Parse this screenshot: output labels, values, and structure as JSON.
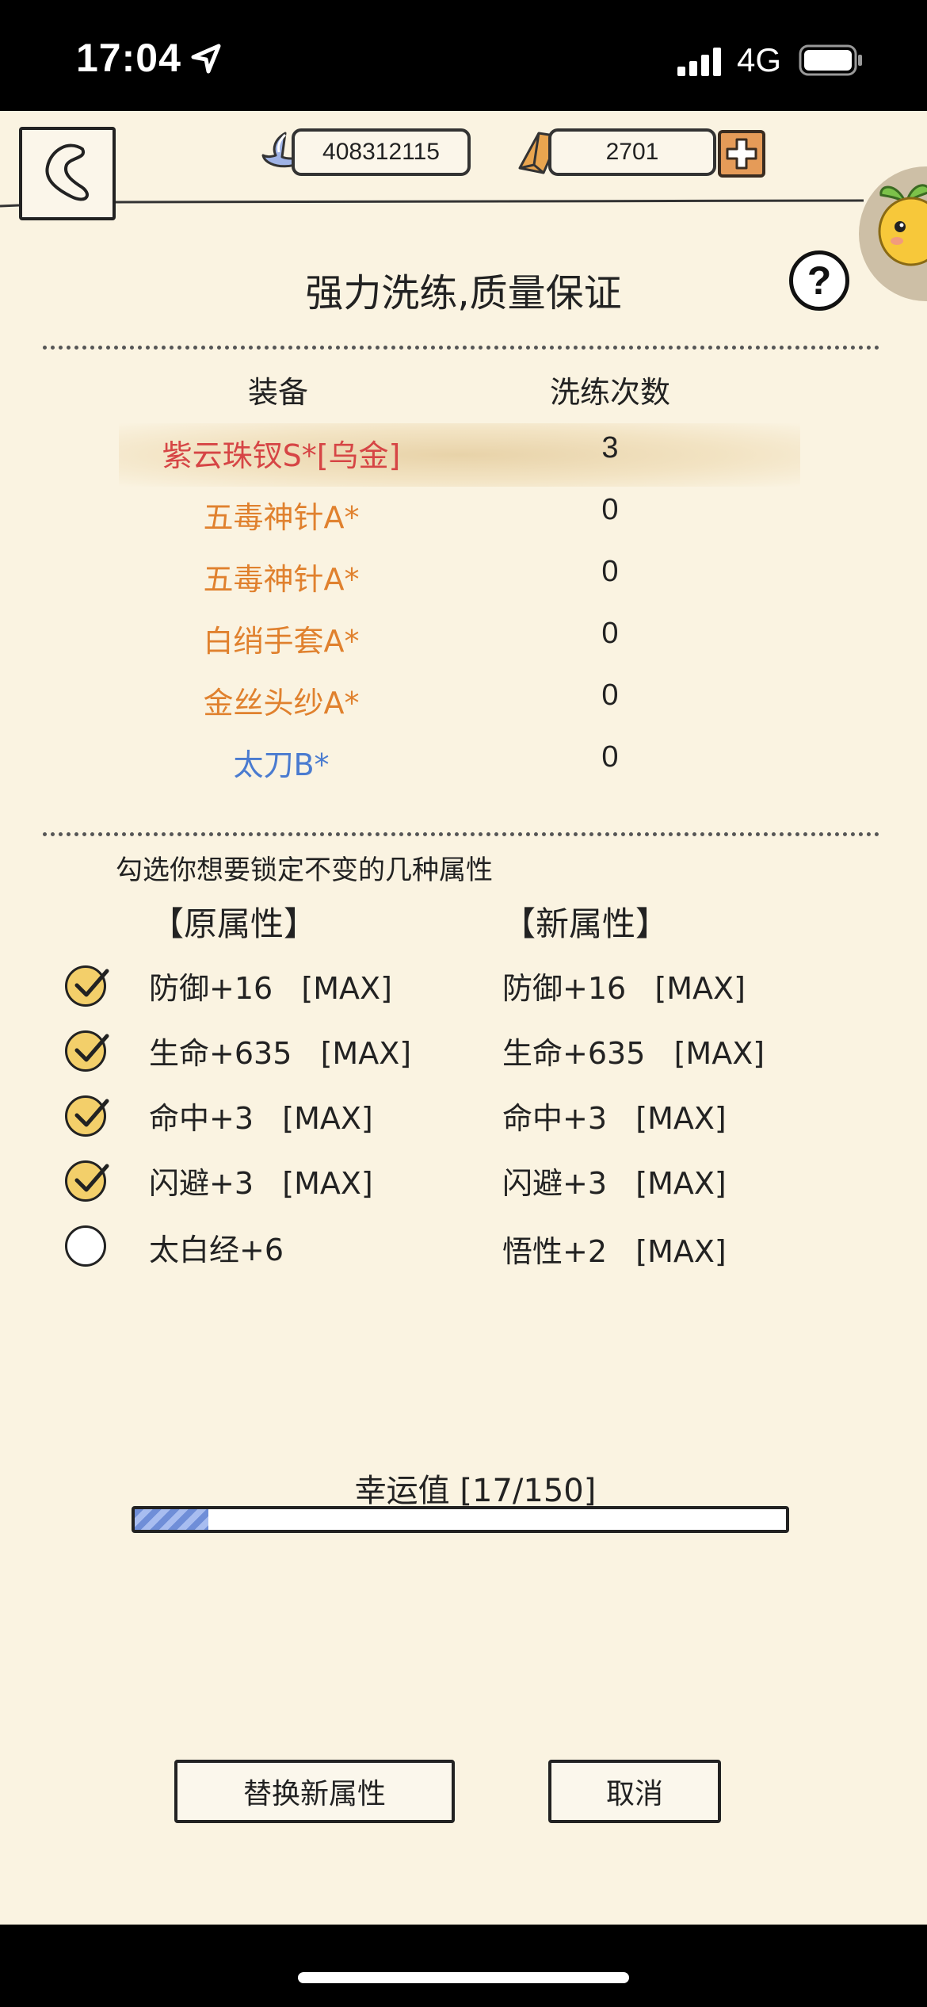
{
  "status_bar": {
    "time": "17:04",
    "network": "4G",
    "icons": [
      "location-arrow-icon",
      "signal-bars-icon",
      "battery-icon"
    ]
  },
  "header": {
    "back_icon": "back-arrow-icon",
    "silver": "408312115",
    "gold": "2701",
    "add_icon": "plus-icon"
  },
  "title": "强力洗练,质量保证",
  "help_label": "?",
  "equipment": {
    "header_name": "装备",
    "header_count": "洗练次数",
    "items": [
      {
        "name": "紫云珠钗S*[乌金]",
        "count": "3",
        "color": "#d64545"
      },
      {
        "name": "五毒神针A*",
        "count": "0",
        "color": "#e0812e"
      },
      {
        "name": "五毒神针A*",
        "count": "0",
        "color": "#e0812e"
      },
      {
        "name": "白绡手套A*",
        "count": "0",
        "color": "#e0812e"
      },
      {
        "name": "金丝头纱A*",
        "count": "0",
        "color": "#e0812e"
      },
      {
        "name": "太刀B*",
        "count": "0",
        "color": "#4a7bd0"
      }
    ],
    "selected_index": 0
  },
  "attributes": {
    "hint": "勾选你想要锁定不变的几种属性",
    "old_heading": "【原属性】",
    "new_heading": "【新属性】",
    "rows": [
      {
        "old": "防御+16   [MAX]",
        "new": "防御+16   [MAX]",
        "locked": true
      },
      {
        "old": "生命+635   [MAX]",
        "new": "生命+635   [MAX]",
        "locked": true
      },
      {
        "old": "命中+3   [MAX]",
        "new": "命中+3   [MAX]",
        "locked": true
      },
      {
        "old": "闪避+3   [MAX]",
        "new": "闪避+3   [MAX]",
        "locked": true
      },
      {
        "old": "太白经+6",
        "new": "悟性+2   [MAX]",
        "locked": false
      }
    ]
  },
  "luck": {
    "label": "幸运值  [17/150]",
    "current": 17,
    "max": 150
  },
  "buttons": {
    "replace": "替换新属性",
    "cancel": "取消"
  }
}
